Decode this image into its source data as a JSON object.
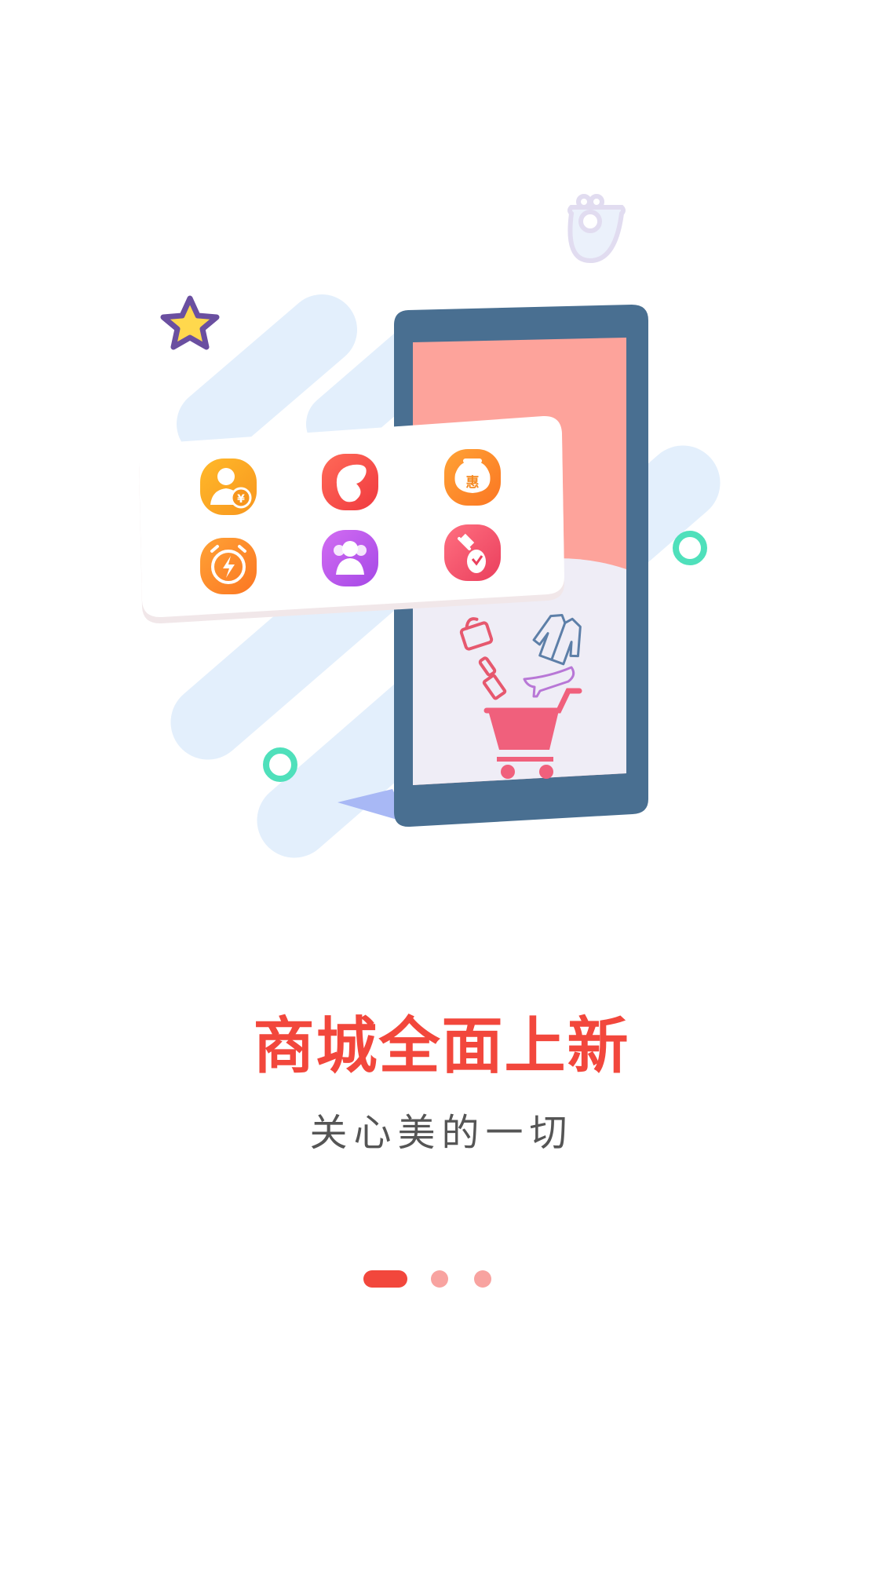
{
  "onboarding": {
    "title": "商城全面上新",
    "subtitle": "关心美的一切",
    "page_indicator": {
      "current": 1,
      "total": 3
    },
    "colors": {
      "title": "#f2473c",
      "subtitle": "#555555",
      "dot_active": "#f2473c",
      "dot_inactive": "#f8a3a0"
    }
  },
  "illustration": {
    "icons": [
      {
        "name": "user-money-icon",
        "label": "¥"
      },
      {
        "name": "bean-icon"
      },
      {
        "name": "discount-bag-icon",
        "label": "惠"
      },
      {
        "name": "alarm-flash-icon"
      },
      {
        "name": "group-icon"
      },
      {
        "name": "auction-icon"
      }
    ]
  }
}
